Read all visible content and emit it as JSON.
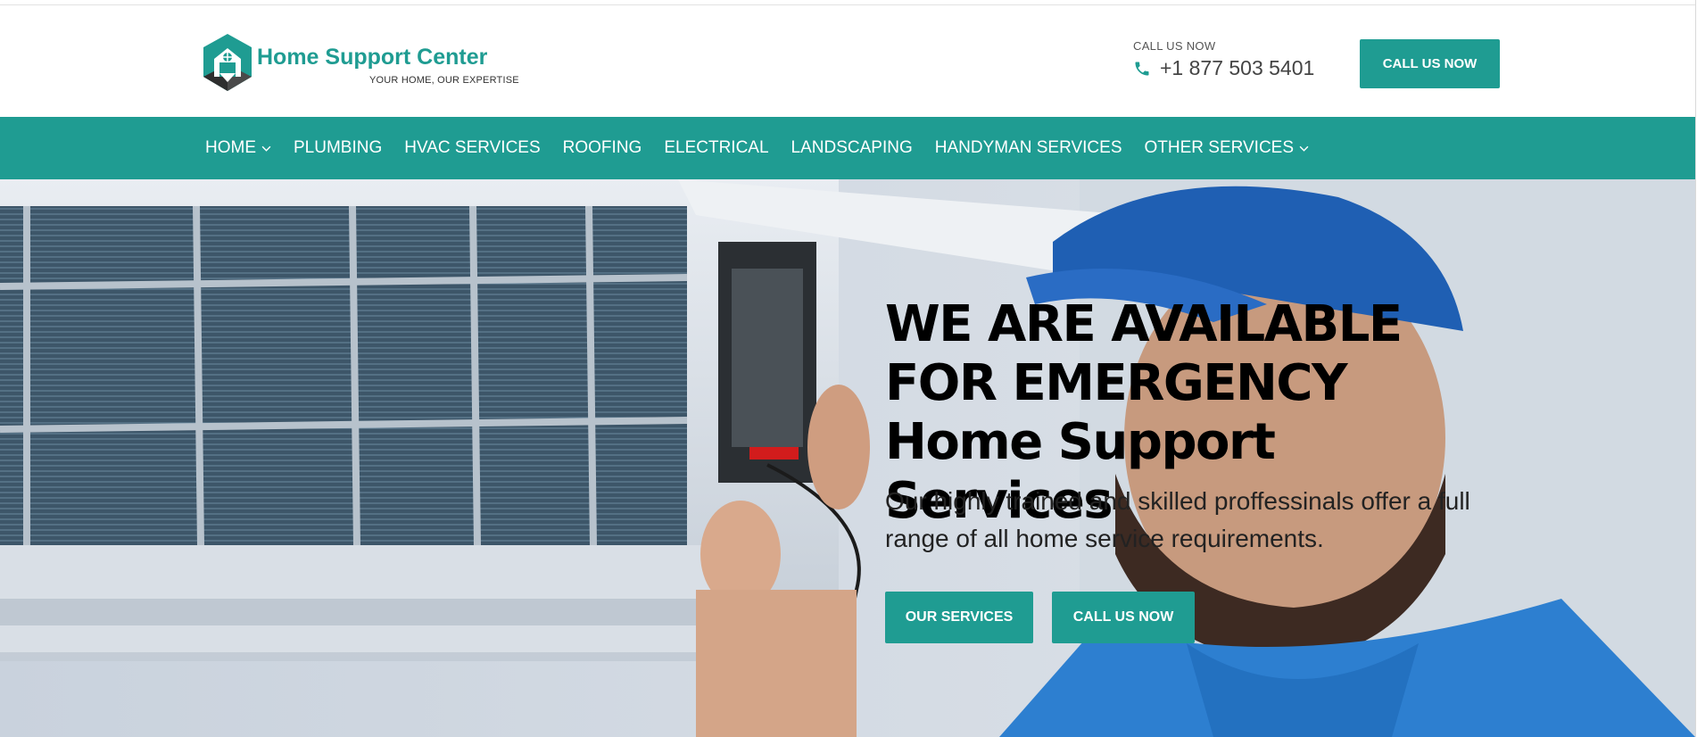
{
  "brand": {
    "name": "Home Support Center",
    "tagline": "YOUR HOME, OUR EXPERTISE",
    "accent_color": "#1f9c92",
    "logo_icon": "house-hexagon-icon"
  },
  "header": {
    "contact_label": "CALL US NOW",
    "phone": "+1 877 503 5401",
    "phone_icon": "phone-icon",
    "cta_label": "CALL US NOW"
  },
  "nav": {
    "items": [
      {
        "label": "HOME",
        "has_dropdown": true
      },
      {
        "label": "PLUMBING",
        "has_dropdown": false
      },
      {
        "label": "HVAC SERVICES",
        "has_dropdown": false
      },
      {
        "label": "ROOFING",
        "has_dropdown": false
      },
      {
        "label": "ELECTRICAL",
        "has_dropdown": false
      },
      {
        "label": "LANDSCAPING",
        "has_dropdown": false
      },
      {
        "label": "HANDYMAN SERVICES",
        "has_dropdown": false
      },
      {
        "label": "OTHER SERVICES",
        "has_dropdown": true
      }
    ]
  },
  "hero": {
    "title": "WE ARE AVAILABLE FOR EMERGENCY Home Support Services",
    "subtitle": "Our highly trained and skilled proffessinals offer a full range of all home service requirements.",
    "primary_button": "OUR SERVICES",
    "secondary_button": "CALL US NOW"
  }
}
